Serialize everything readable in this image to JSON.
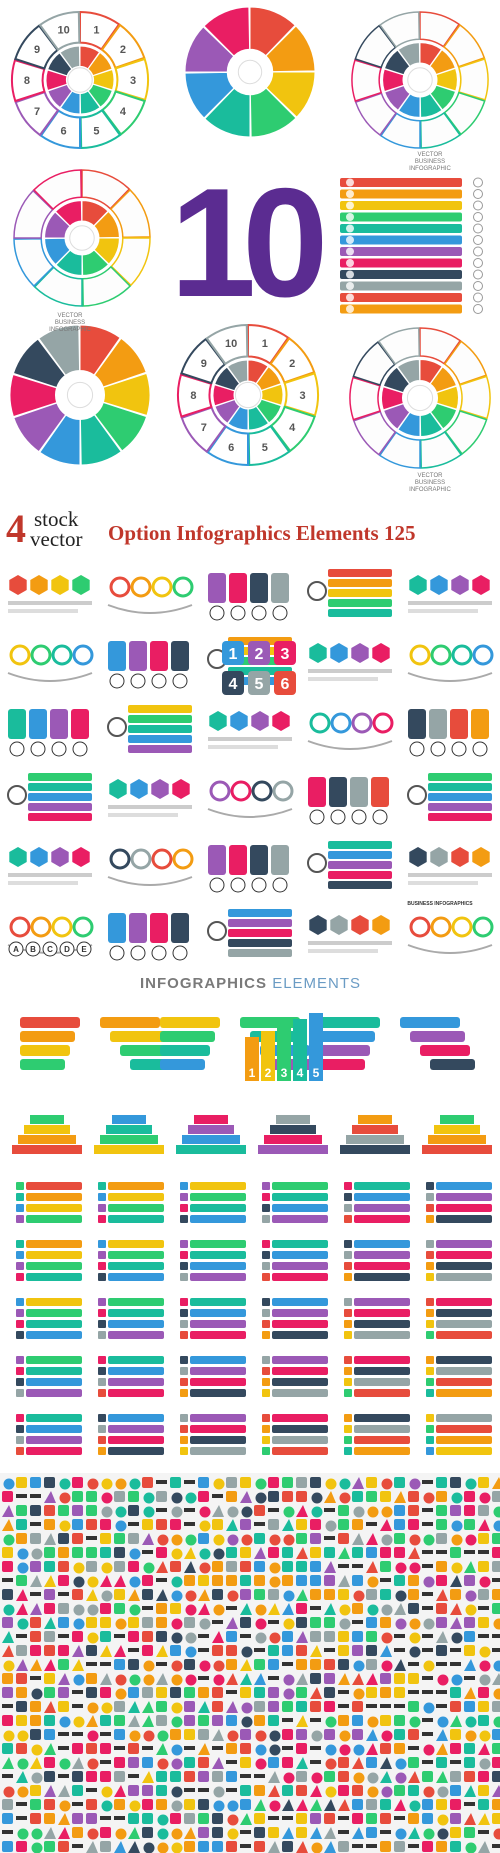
{
  "banner": {
    "logo_number": "4",
    "logo_word1": "stock",
    "logo_word2": "vector",
    "title": "Option Infographics Elements 125"
  },
  "section1": {
    "big_number": "10",
    "wheel_caption_1": "VECTOR",
    "wheel_caption_2": "BUSINESS INFOGRAPHIC",
    "numbers": [
      "1",
      "2",
      "3",
      "4",
      "5",
      "6",
      "7",
      "8",
      "9",
      "10"
    ]
  },
  "section2": {
    "letters_a": [
      "A",
      "B",
      "C",
      "D"
    ],
    "letters_b": [
      "A",
      "B",
      "C",
      "D",
      "E"
    ],
    "numbers": [
      "1",
      "2",
      "3",
      "4",
      "5",
      "6"
    ],
    "caption": "BUSINESS INFOGRAPHICS",
    "clock_labels": [
      "A",
      "B",
      "C",
      "D"
    ]
  },
  "section3": {
    "header_word1": "INFOGRAPHICS",
    "header_word2": "ELEMENTS",
    "numbers": [
      "1",
      "2",
      "3",
      "4",
      "5"
    ]
  },
  "colors": {
    "brand_red": "#c0372b",
    "purple": "#5b2c91",
    "palette": [
      "#e74c3c",
      "#f39c12",
      "#f1c40f",
      "#2ecc71",
      "#1abc9c",
      "#3498db",
      "#9b59b6",
      "#e91e63",
      "#34495e",
      "#95a5a6"
    ]
  }
}
